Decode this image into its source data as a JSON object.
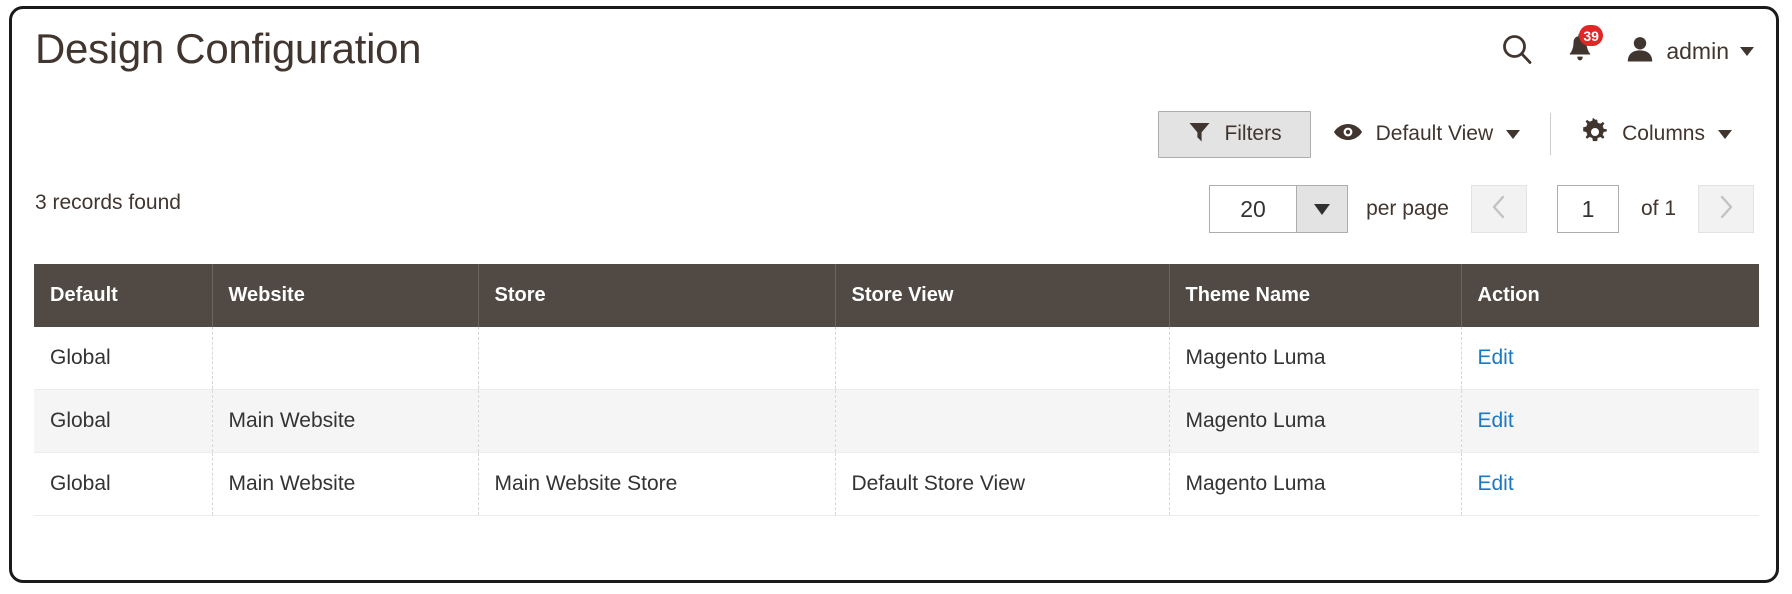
{
  "header": {
    "title": "Design Configuration",
    "search_icon": "search-icon",
    "notifications_icon": "bell-icon",
    "notifications_count": "39",
    "user_icon": "user-avatar-icon",
    "user_name": "admin"
  },
  "toolbar": {
    "filters_label": "Filters",
    "filters_icon": "funnel-icon",
    "view_icon": "eye-icon",
    "view_label": "Default View",
    "columns_icon": "gear-icon",
    "columns_label": "Columns"
  },
  "grid_meta": {
    "records_found": "3 records found",
    "per_page_value": "20",
    "per_page_label": "per page",
    "current_page": "1",
    "pages_total": "of 1",
    "prev_icon": "chevron-left-icon",
    "next_icon": "chevron-right-icon"
  },
  "table": {
    "columns": [
      "Default",
      "Website",
      "Store",
      "Store View",
      "Theme Name",
      "Action"
    ],
    "rows": [
      {
        "default": "Global",
        "website": "",
        "store": "",
        "store_view": "",
        "theme_name": "Magento Luma",
        "action": "Edit"
      },
      {
        "default": "Global",
        "website": "Main Website",
        "store": "",
        "store_view": "",
        "theme_name": "Magento Luma",
        "action": "Edit"
      },
      {
        "default": "Global",
        "website": "Main Website",
        "store": "Main Website Store",
        "store_view": "Default Store View",
        "theme_name": "Magento Luma",
        "action": "Edit"
      }
    ]
  },
  "colors": {
    "header_bar": "#514943",
    "badge_red": "#e22626",
    "link_blue": "#1979c3",
    "text_brown": "#41362f",
    "row_alt": "#f5f5f5"
  }
}
